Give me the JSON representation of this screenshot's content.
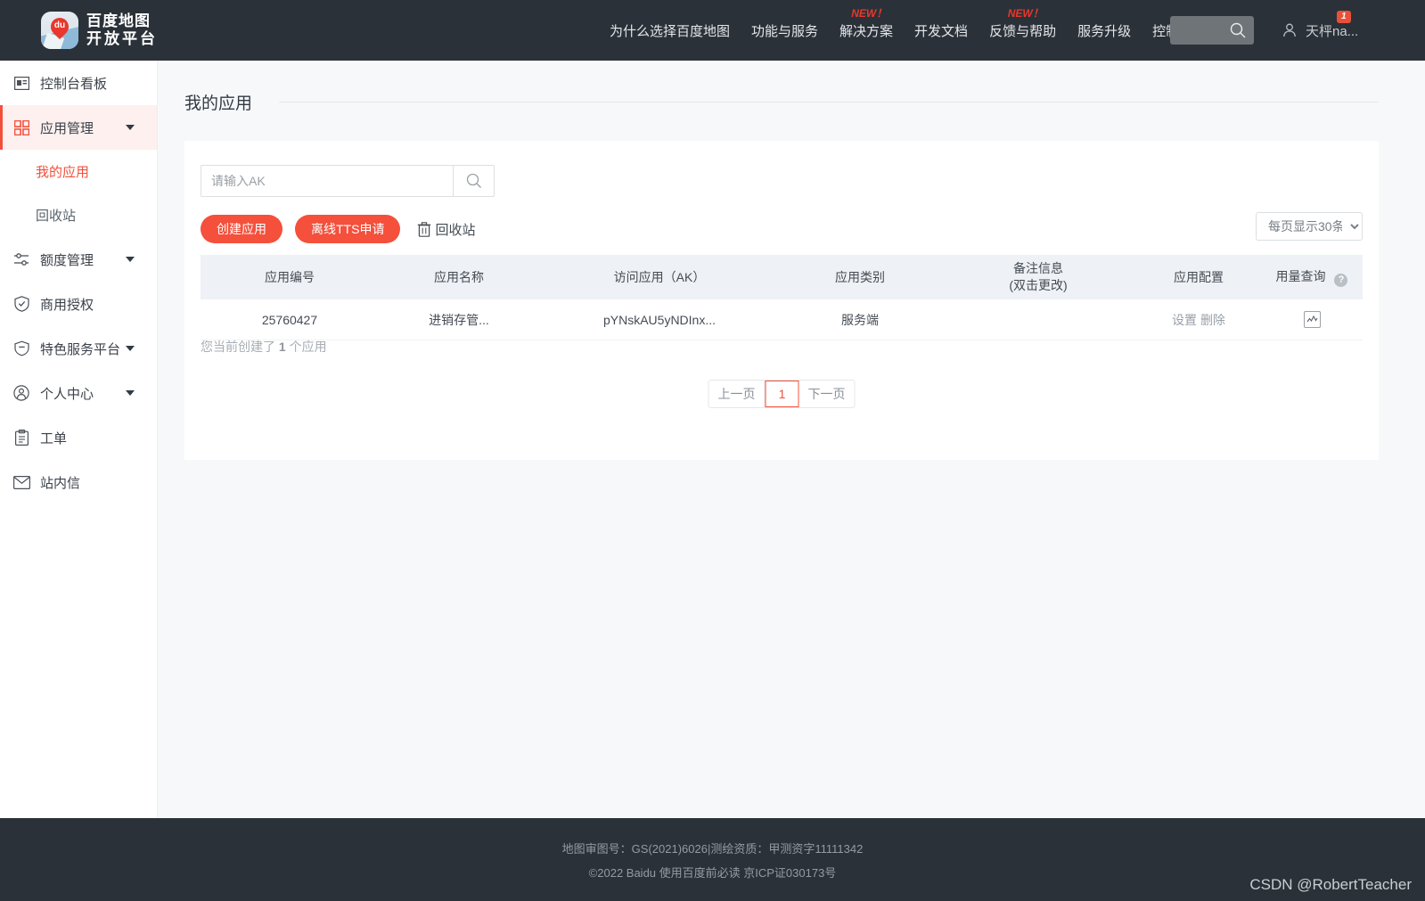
{
  "header": {
    "logo": {
      "line1": "百度地图",
      "line2": "开放平台",
      "pin_text": "du"
    },
    "nav": [
      {
        "label": "为什么选择百度地图",
        "badge": ""
      },
      {
        "label": "功能与服务",
        "badge": ""
      },
      {
        "label": "解决方案",
        "badge": "NEW！"
      },
      {
        "label": "开发文档",
        "badge": ""
      },
      {
        "label": "反馈与帮助",
        "badge": "NEW！"
      },
      {
        "label": "服务升级",
        "badge": ""
      },
      {
        "label": "控制台",
        "badge": ""
      }
    ],
    "search_icon": "search-icon",
    "user": {
      "name": "天枰na...",
      "badge": "1",
      "avatar_icon": "user-icon"
    }
  },
  "sidebar": {
    "items": [
      {
        "label": "控制台看板",
        "icon": "dashboard-icon",
        "caret": false,
        "active": false
      },
      {
        "label": "应用管理",
        "icon": "apps-grid-icon",
        "caret": true,
        "active": true
      },
      {
        "label": "额度管理",
        "icon": "sliders-icon",
        "caret": true,
        "active": false
      },
      {
        "label": "商用授权",
        "icon": "shield-check-icon",
        "caret": false,
        "active": false
      },
      {
        "label": "特色服务平台",
        "icon": "shield-minus-icon",
        "caret": true,
        "active": false
      },
      {
        "label": "个人中心",
        "icon": "user-circle-icon",
        "caret": true,
        "active": false
      },
      {
        "label": "工单",
        "icon": "clipboard-icon",
        "caret": false,
        "active": false
      },
      {
        "label": "站内信",
        "icon": "mail-icon",
        "caret": false,
        "active": false
      }
    ],
    "sub_items": [
      {
        "label": "我的应用",
        "active": true
      },
      {
        "label": "回收站",
        "active": false
      }
    ]
  },
  "main": {
    "page_title": "我的应用",
    "search": {
      "placeholder": "请输入AK",
      "value": "",
      "icon": "search-icon"
    },
    "actions": {
      "create_app": "创建应用",
      "offline_tts": "离线TTS申请",
      "recycle_bin": "回收站",
      "recycle_icon": "trash-icon"
    },
    "page_size": {
      "selected": "每页显示30条",
      "options": [
        "每页显示30条"
      ]
    },
    "table": {
      "columns": [
        {
          "label": "应用编号"
        },
        {
          "label": "应用名称"
        },
        {
          "label": "访问应用（AK）"
        },
        {
          "label": "应用类别"
        },
        {
          "label": "备注信息",
          "sub": "(双击更改)"
        },
        {
          "label": "应用配置"
        },
        {
          "label": "用量查询",
          "help": "?"
        }
      ],
      "rows": [
        {
          "app_id": "25760427",
          "app_name": "进销存管...",
          "ak": "pYNskAU5yNDInx...",
          "category": "服务端",
          "remark": "",
          "config_settings": "设置",
          "config_delete": "删除",
          "usage_icon": "chart-icon"
        }
      ]
    },
    "count_text_prefix": "您当前创建了",
    "count_value": "1",
    "count_text_suffix": "个应用",
    "pager": {
      "prev": "上一页",
      "pages": [
        "1"
      ],
      "next": "下一页",
      "current": "1"
    }
  },
  "footer": {
    "line1": "地图审图号：GS(2021)6026|测绘资质：甲测资字11111342",
    "line2": "©2022 Baidu 使用百度前必读 京ICP证030173号"
  },
  "watermark": "CSDN @RobertTeacher",
  "colors": {
    "accent": "#f4503c",
    "header_bg": "#2b3138",
    "panel_bg": "#ffffff",
    "page_bg": "#f7f8fa"
  }
}
